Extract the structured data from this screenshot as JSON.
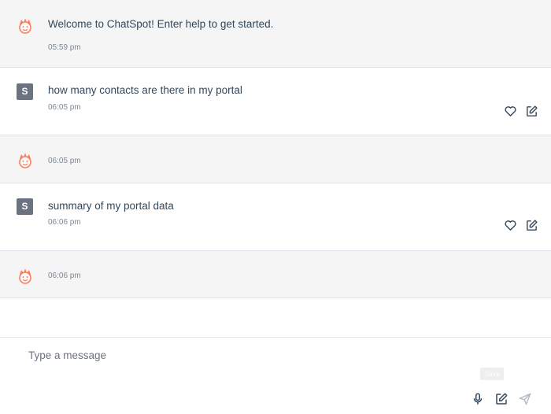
{
  "messages": [
    {
      "sender": "bot",
      "text": "Welcome to ChatSpot! Enter help to get started.",
      "time": "05:59 pm"
    },
    {
      "sender": "user",
      "avatar_letter": "S",
      "text": "how many contacts are there in my portal",
      "time": "06:05 pm"
    },
    {
      "sender": "bot",
      "text": "",
      "time": "06:05 pm"
    },
    {
      "sender": "user",
      "avatar_letter": "S",
      "text": "summary of my portal data",
      "time": "06:06 pm"
    },
    {
      "sender": "bot",
      "text": "",
      "time": "06:06 pm"
    }
  ],
  "composer": {
    "placeholder": "Type a message",
    "tooltip": "Save"
  },
  "icons": {
    "bot_avatar": "chatspot-bot-icon",
    "like": "heart-icon",
    "edit": "edit-icon",
    "mic": "microphone-icon",
    "send": "send-icon"
  },
  "colors": {
    "bot_accent": "#ff7a59",
    "bot_row_bg": "#f5f5f5",
    "user_avatar_bg": "#6b7280"
  }
}
